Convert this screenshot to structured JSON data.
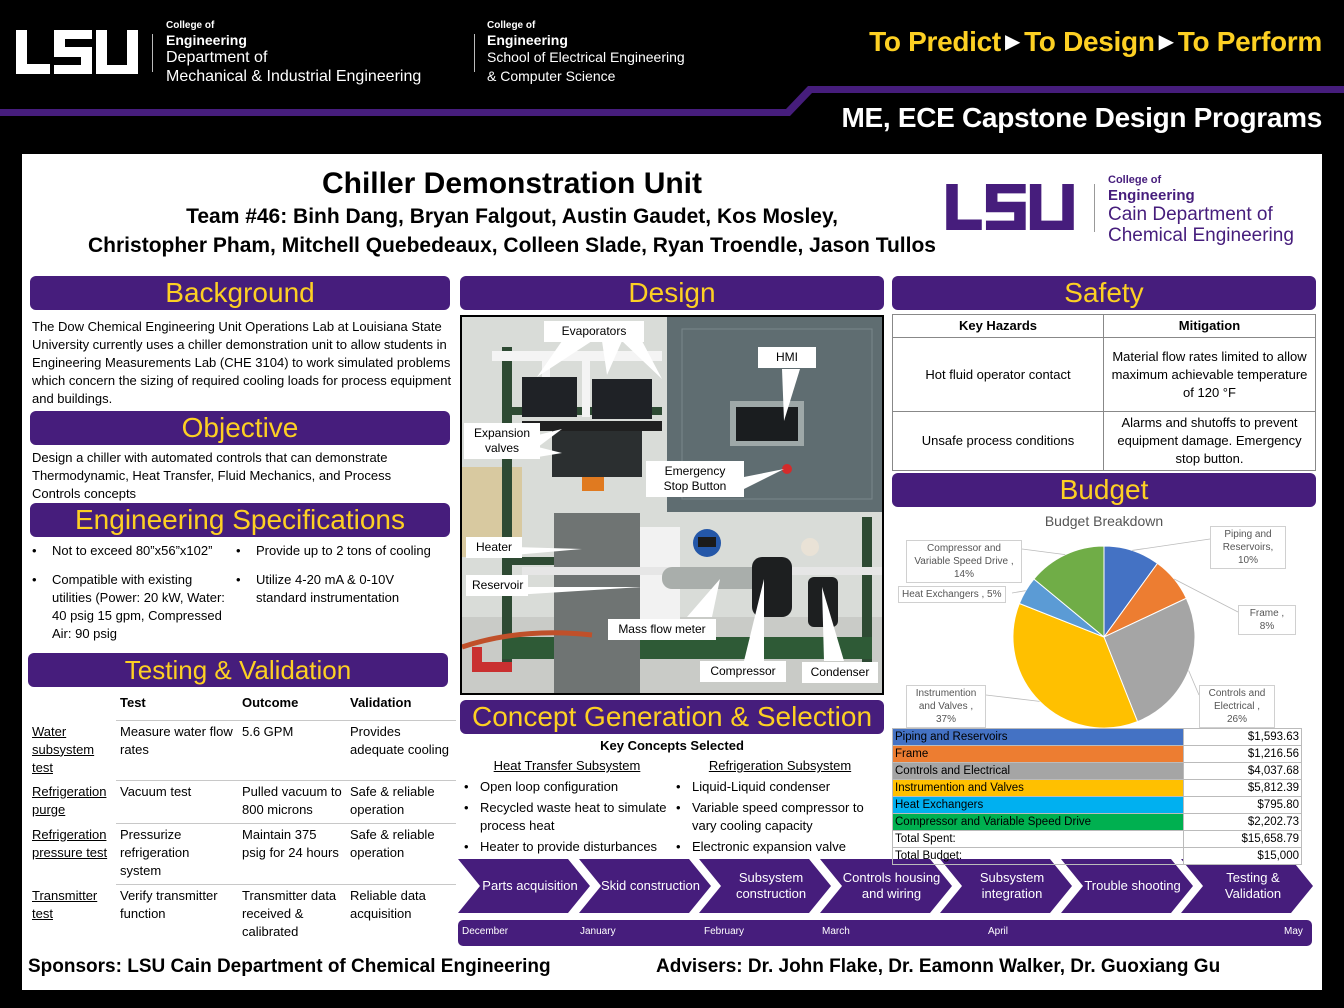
{
  "header": {
    "logo_text": "LSU",
    "dept1": {
      "college": "College of",
      "engineering": "Engineering",
      "line1": "Department of",
      "line2": "Mechanical & Industrial Engineering"
    },
    "dept2": {
      "college": "College of",
      "engineering": "Engineering",
      "line1": "School of Electrical Engineering",
      "line2": "& Computer Science"
    },
    "tagline": {
      "part1": "To Predict",
      "part2": "To Design",
      "part3": "To Perform",
      "arrow": "▶"
    },
    "program": "ME, ECE Capstone Design Programs"
  },
  "poster": {
    "title": "Chiller Demonstration Unit",
    "team_line1": "Team #46: Binh Dang, Bryan Falgout, Austin Gaudet, Kos Mosley,",
    "team_line2": "Christopher Pham, Mitchell Quebedeaux, Colleen Slade, Ryan Troendle, Jason Tullos",
    "cain_logo": {
      "logo_text": "LSU",
      "college": "College of",
      "engineering": "Engineering",
      "line1": "Cain Department of",
      "line2": "Chemical Engineering"
    }
  },
  "colors": {
    "purple": "#461d7c",
    "gold": "#fdd023"
  },
  "background": {
    "heading": "Background",
    "text": "The Dow Chemical Engineering Unit Operations Lab at Louisiana State University currently uses a chiller demonstration unit to allow students in Engineering Measurements Lab (CHE 3104) to work simulated problems which concern the sizing of required cooling loads for process equipment and buildings."
  },
  "objective": {
    "heading": "Objective",
    "text": "Design a chiller with automated controls that can demonstrate Thermodynamic, Heat  Transfer, Fluid Mechanics, and Process Controls concepts"
  },
  "specs": {
    "heading": "Engineering Specifications",
    "bullet": "•",
    "items": [
      "Not to exceed 80”x56”x102”",
      "Provide up to 2 tons of cooling",
      "Compatible with existing utilities (Power: 20 kW, Water: 40 psig 15 gpm, Compressed Air: 90 psig",
      "Utilize 4-20 mA & 0-10V standard instrumentation"
    ]
  },
  "testing": {
    "heading": "Testing & Validation",
    "columns": [
      "",
      "Test",
      "Outcome",
      "Validation"
    ],
    "rows": [
      {
        "label": "Water subsystem test",
        "test": "Measure water flow rates",
        "outcome": "5.6 GPM",
        "validation": "Provides adequate cooling"
      },
      {
        "label": "Refrigeration purge",
        "test": "Vacuum test",
        "outcome": "Pulled vacuum to 800 microns",
        "validation": "Safe & reliable operation"
      },
      {
        "label": "Refrigeration pressure test",
        "test": "Pressurize refrigeration system",
        "outcome": "Maintain 375 psig for 24 hours",
        "validation": "Safe & reliable operation"
      },
      {
        "label": "Transmitter test",
        "test": "Verify transmitter function",
        "outcome": "Transmitter data received & calibrated",
        "validation": "Reliable data acquisition"
      }
    ]
  },
  "design": {
    "heading": "Design",
    "callouts": {
      "evaporators": "Evaporators",
      "hmi": "HMI",
      "expansion_valves": "Expansion valves",
      "estop": "Emergency Stop Button",
      "heater": "Heater",
      "reservoir": "Reservoir",
      "mass_flow": "Mass flow meter",
      "compressor": "Compressor",
      "condenser": "Condenser"
    }
  },
  "concepts": {
    "heading": "Concept Generation & Selection",
    "subtitle": "Key Concepts Selected",
    "bullet": "•",
    "heat_transfer": {
      "title": "Heat Transfer Subsystem",
      "items": [
        "Open loop configuration",
        "Recycled waste heat to simulate process heat",
        "Heater to provide disturbances"
      ]
    },
    "refrigeration": {
      "title": "Refrigeration Subsystem",
      "items": [
        "Liquid-Liquid condenser",
        "Variable speed compressor to vary cooling capacity",
        "Electronic expansion valve"
      ]
    }
  },
  "timeline": {
    "steps": [
      "Parts acquisition",
      "Skid construction",
      "Subsystem construction",
      "Controls housing and wiring",
      "Subsystem integration",
      "Trouble shooting",
      "Testing & Validation"
    ],
    "months": [
      "December",
      "January",
      "February",
      "March",
      "April",
      "May"
    ]
  },
  "safety": {
    "heading": "Safety",
    "columns": [
      "Key Hazards",
      "Mitigation"
    ],
    "rows": [
      {
        "hazard": "Hot fluid operator contact",
        "mitigation": "Material flow rates limited to allow maximum achievable temperature of 120 °F"
      },
      {
        "hazard": "Unsafe process conditions",
        "mitigation": "Alarms and shutoffs to prevent equipment damage. Emergency stop button."
      }
    ]
  },
  "budget": {
    "heading": "Budget",
    "items": [
      {
        "name": "Piping and Reservoirs",
        "amount": "$1,593.63",
        "color": "#4472c4"
      },
      {
        "name": "Frame",
        "amount": "$1,216.56",
        "color": "#ed7d31"
      },
      {
        "name": "Controls and Electrical",
        "amount": "$4,037.68",
        "color": "#a5a5a5"
      },
      {
        "name": "Instrumention and Valves",
        "amount": "$5,812.39",
        "color": "#ffc000"
      },
      {
        "name": "Heat Exchangers",
        "amount": "$795.80",
        "color": "#00b0f0"
      },
      {
        "name": "Compressor and Variable Speed Drive",
        "amount": "$2,202.73",
        "color": "#00b050"
      }
    ],
    "total_spent_label": "Total Spent:",
    "total_spent": "$15,658.79",
    "total_budget_label": "Total Budget:",
    "total_budget": "$15,000"
  },
  "chart_data": {
    "type": "pie",
    "title": "Budget Breakdown",
    "categories": [
      "Piping and Reservoirs",
      "Frame",
      "Controls and Electrical",
      "Instrumention and Valves",
      "Heat Exchangers",
      "Compressor and Variable Speed Drive"
    ],
    "values": [
      10,
      8,
      26,
      37,
      5,
      14
    ],
    "labels": [
      "Piping and Reservoirs, 10%",
      "Frame , 8%",
      "Controls and Electrical , 26%",
      "Instrumention and Valves , 37%",
      "Heat Exchangers , 5%",
      "Compressor and Variable Speed Drive , 14%"
    ],
    "colors": [
      "#4472c4",
      "#ed7d31",
      "#a5a5a5",
      "#ffc000",
      "#5b9bd5",
      "#70ad47"
    ],
    "legend": "none"
  },
  "footer": {
    "sponsors": "Sponsors: LSU Cain Department of Chemical Engineering",
    "advisers": "Advisers: Dr. John Flake, Dr. Eamonn Walker, Dr. Guoxiang Gu"
  }
}
